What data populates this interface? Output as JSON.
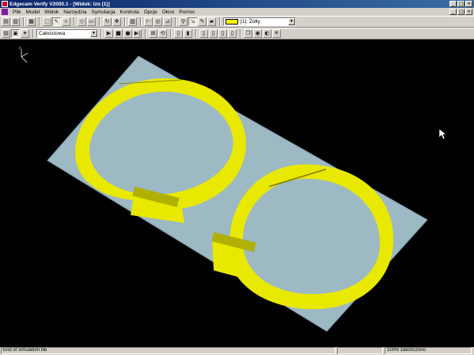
{
  "window": {
    "title": "Edgecam Verify  V2000.1  - [Widok: Izo (1)]",
    "buttons": {
      "minimize": "_",
      "maximize": "□",
      "close": "×"
    }
  },
  "menubar": {
    "items": [
      "Plik",
      "Model",
      "Widok",
      "Narzędzia",
      "Symulacja",
      "Kontrola",
      "Opcje",
      "Okno",
      "Pomoc"
    ]
  },
  "toolbar1": {
    "color_selector": {
      "value": "[1]: Żółty",
      "color": "#ffff00"
    }
  },
  "toolbar2": {
    "mode_selector": {
      "value": "Całościowa"
    }
  },
  "viewport": {
    "background": "#000000",
    "stock_color": "#9cb9c4",
    "toolpath_color": "#e8e800",
    "cursor": "arrow"
  },
  "statusbar": {
    "message": "End of simulation file",
    "progress": "100% zakończono"
  }
}
